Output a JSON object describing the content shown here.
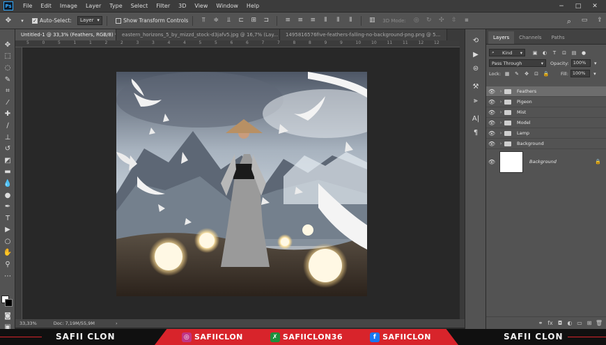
{
  "app": {
    "logo": "Ps"
  },
  "menu": [
    "File",
    "Edit",
    "Image",
    "Layer",
    "Type",
    "Select",
    "Filter",
    "3D",
    "View",
    "Window",
    "Help"
  ],
  "window_controls": [
    "−",
    "□",
    "✕"
  ],
  "options_bar": {
    "auto_select_label": "Auto-Select:",
    "auto_select_value": "Layer",
    "transform_controls_label": "Show Transform Controls",
    "mode_3d_label": "3D Mode:"
  },
  "tabs": [
    {
      "label": "Untitled-1 @ 33,3% (Feathers, RGB/8) *",
      "active": true
    },
    {
      "label": "eastern_horizons_5_by_mizzd_stock-d3jafv5.jpg @ 16,7% (Lay...",
      "active": false
    },
    {
      "label": "1495816576five-feathers-falling-no-background-png.png @ 5...",
      "active": false
    }
  ],
  "ruler_labels": [
    "5",
    "0",
    "5",
    "1",
    "1",
    "2",
    "2",
    "3",
    "3",
    "4",
    "4",
    "5",
    "5",
    "6",
    "6",
    "7",
    "7",
    "8",
    "8",
    "9",
    "9",
    "10",
    "10",
    "11",
    "11",
    "12",
    "12"
  ],
  "status": {
    "zoom": "33,33%",
    "doc": "Doc: 7,19M/55,9M"
  },
  "panel": {
    "tabs": [
      "Layers",
      "Channels",
      "Paths"
    ],
    "filter_kind": "Kind",
    "blend_mode": "Pass Through",
    "opacity_label": "Opacity:",
    "opacity_value": "100%",
    "lock_label": "Lock:",
    "fill_label": "Fill:",
    "fill_value": "100%",
    "layers": [
      {
        "name": "Feathers",
        "selected": true
      },
      {
        "name": "Pigeon",
        "selected": false
      },
      {
        "name": "Mist",
        "selected": false
      },
      {
        "name": "Model",
        "selected": false
      },
      {
        "name": "Lamp",
        "selected": false
      },
      {
        "name": "Background",
        "selected": false
      }
    ],
    "background_layer": "Background"
  },
  "banner": {
    "left": "SAFII CLON",
    "right": "SAFII CLON",
    "instagram": "SAFIICLON",
    "deviantart": "SAFIICLON36",
    "facebook": "SAFIICLON"
  },
  "colors": {
    "accent": "#31a8ff",
    "banner_red": "#d8242b"
  }
}
